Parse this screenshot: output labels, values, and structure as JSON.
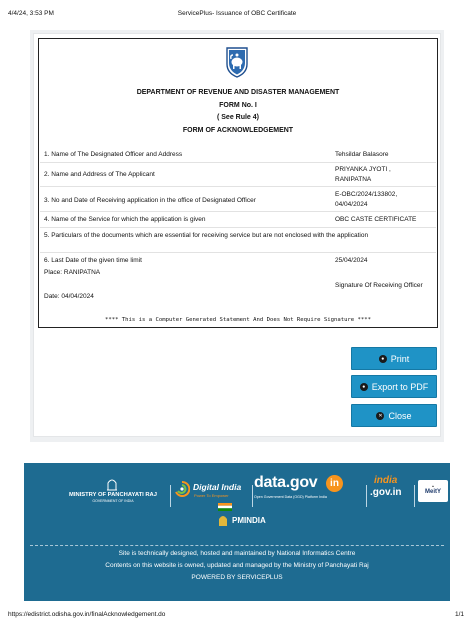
{
  "print_header": {
    "datetime": "4/4/24, 3:53 PM",
    "page_title": "ServicePlus- Issuance of OBC Certificate"
  },
  "certificate": {
    "department": "DEPARTMENT OF REVENUE AND DISASTER MANAGEMENT",
    "form_no": "FORM No. I",
    "rule": "( See Rule 4)",
    "form_title": "FORM OF ACKNOWLEDGEMENT",
    "rows": [
      {
        "label": "1. Name of The Designated Officer and Address",
        "value": "Tehsildar Balasore"
      },
      {
        "label": "2. Name and Address of The Applicant",
        "value": "PRIYANKA JYOTI ,\nRANIPATNA"
      },
      {
        "label": "3. No and Date of Receiving application in the office of Designated Officer",
        "value": "E-OBC/2024/133802,\n04/04/2024"
      },
      {
        "label": "4. Name of the Service for which the application is given",
        "value": "OBC CASTE CERTIFICATE"
      },
      {
        "label": "5. Particulars of the documents which are essential for receiving service but are not enclosed with the application",
        "value": ""
      },
      {
        "label": "6. Last Date of the given time limit",
        "value": "25/04/2024"
      }
    ],
    "place": "Place: RANIPATNA",
    "signature": "Signature Of Receiving Officer",
    "date": "Date: 04/04/2024",
    "note": "**** This is a Computer Generated Statement And Does Not Require Signature ****"
  },
  "buttons": {
    "print": "Print",
    "export": "Export to PDF",
    "close": "Close"
  },
  "footer": {
    "logos": {
      "panchayati_raj": "MINISTRY OF PANCHAYATI RAJ",
      "panchayati_raj_sub": "GOVERNMENT OF INDIA",
      "digital_india": "Digital India",
      "digital_india_tag": "Power To Empower",
      "data_gov": "data.gov",
      "data_gov_in": "in",
      "data_gov_tag": "Open Government Data (OGD) Platform India",
      "india_gov": "india",
      "india_gov_in": ".gov.in",
      "meity": "MeitY",
      "pmindia": "PMINDIA"
    },
    "lines": [
      "Site is technically designed, hosted and maintained by National Informatics Centre",
      "Contents on this website is owned, updated and managed by the Ministry of Panchayati Raj",
      "POWERED BY SERVICEPLUS"
    ]
  },
  "print_footer": {
    "url": "https://edistrict.odisha.gov.in/finalAcknowledgement.do",
    "page": "1/1"
  },
  "colors": {
    "button": "#1f93c6",
    "footer": "#1e6b91"
  }
}
